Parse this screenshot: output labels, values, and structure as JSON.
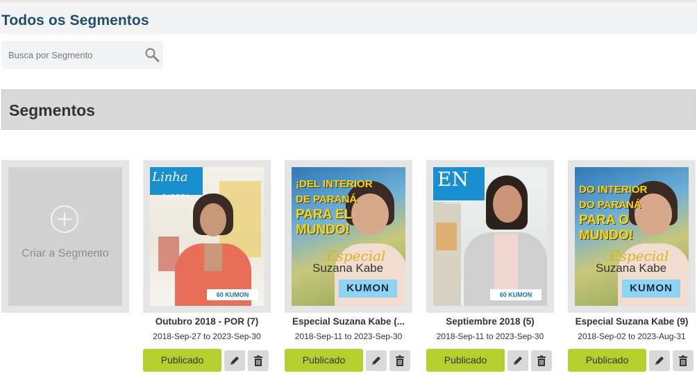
{
  "page": {
    "title": "Todos os Segmentos"
  },
  "search": {
    "placeholder": "Busca por Segmento",
    "icon": "search-icon"
  },
  "section": {
    "title": "Segmentos"
  },
  "create_card": {
    "label": "Criar a Segmento",
    "icon": "plus-circle-icon"
  },
  "segments": [
    {
      "name": "Outubro 2018 - POR (7)",
      "dates": "2018-Sep-27 to 2023-Sep-30",
      "status": "Publicado",
      "cover": {
        "logo_line1": "Linha",
        "logo_line2": "DIRETA",
        "badge": "60 KUMON"
      }
    },
    {
      "name": "Especial Suzana Kabe (...",
      "dates": "2018-Sep-11 to 2023-Sep-30",
      "status": "Publicado",
      "cover": {
        "headline1": "¡DEL INTERIOR",
        "headline2": "DE PARANÁ",
        "headline3": "PARA EL",
        "headline4": "MUNDO!",
        "especial": "Especial",
        "person": "Suzana Kabe",
        "badge": "KUMON"
      }
    },
    {
      "name": "Septiembre 2018 (5)",
      "dates": "2018-Sep-11 to 2023-Sep-30",
      "status": "Publicado",
      "cover": {
        "logo_line1": "EN",
        "logo_line2": "DIRECTO",
        "badge": "60 KUMON"
      }
    },
    {
      "name": "Especial Suzana Kabe (9)",
      "dates": "2018-Sep-02 to 2023-Aug-31",
      "status": "Publicado",
      "cover": {
        "headline1": "DO INTERIOR",
        "headline2": "DO PARANÁ",
        "headline3": "PARA O",
        "headline4": "MUNDO!",
        "especial": "Especial",
        "person": "Suzana Kabe",
        "badge": "KUMON"
      }
    }
  ],
  "colors": {
    "accent": "#b5cf2e",
    "title": "#1f4e6b",
    "section_bg": "#d9d9d9"
  }
}
